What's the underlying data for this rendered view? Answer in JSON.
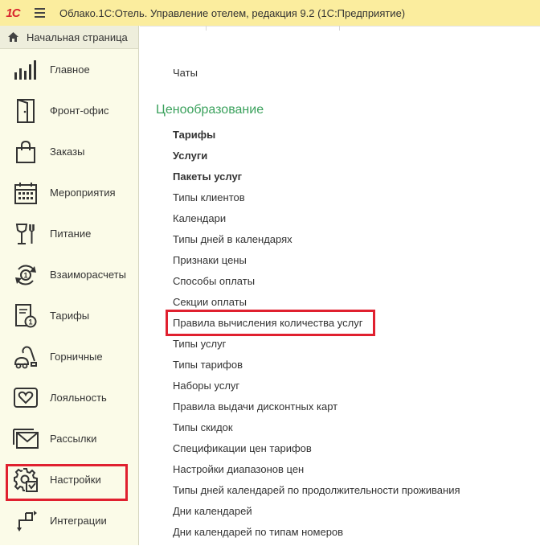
{
  "app": {
    "logo": "1С",
    "window_title": "Облако.1С:Отель. Управление отелем, редакция 9.2  (1С:Предприятие)"
  },
  "sidebar": {
    "home_label": "Начальная страница",
    "items": [
      {
        "label": "Главное",
        "icon": "bar-chart-icon"
      },
      {
        "label": "Фронт-офис",
        "icon": "door-icon"
      },
      {
        "label": "Заказы",
        "icon": "shopping-bag-icon"
      },
      {
        "label": "Мероприятия",
        "icon": "calendar-icon"
      },
      {
        "label": "Питание",
        "icon": "glass-fork-icon"
      },
      {
        "label": "Взаиморасчеты",
        "icon": "coin-cycle-icon"
      },
      {
        "label": "Тарифы",
        "icon": "tariff-coin-icon"
      },
      {
        "label": "Горничные",
        "icon": "vacuum-cleaner-icon"
      },
      {
        "label": "Лояльность",
        "icon": "heart-card-icon"
      },
      {
        "label": "Рассылки",
        "icon": "envelope-icon"
      },
      {
        "label": "Настройки",
        "icon": "gear-icon"
      },
      {
        "label": "Интеграции",
        "icon": "integration-arrows-icon"
      }
    ]
  },
  "main": {
    "top_link": "Чаты",
    "section_title": "Ценообразование",
    "links": [
      {
        "label": "Тарифы",
        "bold": true
      },
      {
        "label": "Услуги",
        "bold": true
      },
      {
        "label": "Пакеты услуг",
        "bold": true
      },
      {
        "label": "Типы клиентов"
      },
      {
        "label": "Календари"
      },
      {
        "label": "Типы дней в календарях"
      },
      {
        "label": "Признаки цены"
      },
      {
        "label": "Способы оплаты"
      },
      {
        "label": "Секции оплаты"
      },
      {
        "label": "Правила вычисления количества услуг"
      },
      {
        "label": "Типы услуг"
      },
      {
        "label": "Типы тарифов"
      },
      {
        "label": "Наборы услуг"
      },
      {
        "label": "Правила выдачи дисконтных карт"
      },
      {
        "label": "Типы скидок"
      },
      {
        "label": "Спецификации цен тарифов"
      },
      {
        "label": "Настройки диапазонов цен"
      },
      {
        "label": "Типы дней календарей по продолжительности проживания"
      },
      {
        "label": "Дни календарей"
      },
      {
        "label": "Дни календарей по типам номеров"
      }
    ]
  },
  "colors": {
    "titlebar_bg": "#fbed9e",
    "sidebar_bg": "#fbfbe8",
    "section_title": "#3aa15c",
    "highlight": "#e0202f",
    "logo": "#d8262e"
  }
}
